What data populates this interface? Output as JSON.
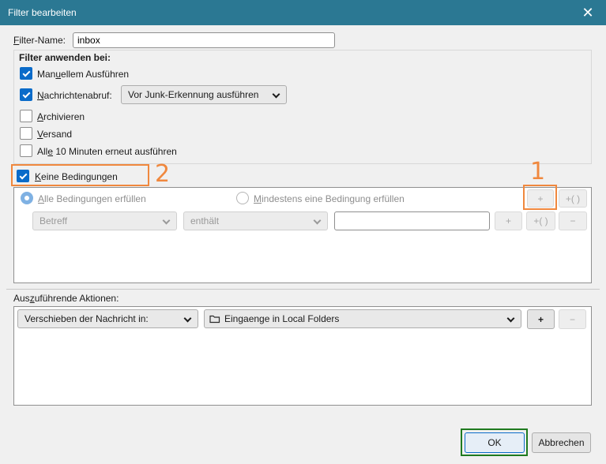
{
  "window": {
    "title": "Filter bearbeiten",
    "close_glyph": "✕"
  },
  "filter_name": {
    "label_prefix": "F",
    "label_rest": "ilter-Name:",
    "value": "inbox"
  },
  "apply_when": {
    "heading": "Filter anwenden bei:",
    "options": [
      {
        "pre": "Man",
        "key": "u",
        "post": "ellem Ausführen",
        "checked": true
      },
      {
        "pre": "",
        "key": "N",
        "post": "achrichtenabruf:",
        "checked": true
      },
      {
        "pre": "",
        "key": "A",
        "post": "rchivieren",
        "checked": false
      },
      {
        "pre": "",
        "key": "V",
        "post": "ersand",
        "checked": false
      },
      {
        "pre": "All",
        "key": "e",
        "post": " 10 Minuten erneut ausführen",
        "checked": false
      }
    ],
    "fetch_mode": "Vor Junk-Erkennung ausführen"
  },
  "conditions": {
    "no_conditions_pre": "",
    "no_conditions_key": "K",
    "no_conditions_post": "eine Bedingungen",
    "no_conditions_checked": true,
    "match_all_pre": "",
    "match_all_key": "A",
    "match_all_post": "lle Bedingungen erfüllen",
    "match_any_pre": "",
    "match_any_key": "M",
    "match_any_post": "indestens eine Bedingung erfüllen",
    "add_label": "+",
    "add_group_label": "+( )",
    "row": {
      "field": "Betreff",
      "operator": "enthält",
      "value": "",
      "add_label": "+",
      "add_group_label": "+( )",
      "remove_label": "−"
    }
  },
  "actions": {
    "heading_pre": "Aus",
    "heading_key": "z",
    "heading_post": "uführende Aktionen:",
    "action": "Verschieben der Nachricht in:",
    "target": "Eingaenge in Local Folders",
    "target_icon": "folder-icon",
    "add_label": "+",
    "remove_label": "−"
  },
  "footer": {
    "ok_label": "OK",
    "cancel_label": "Abbrechen"
  },
  "annotations": {
    "one": "1",
    "two": "2",
    "color": "#f0883e",
    "ok_highlight_color": "#1f7a1f"
  }
}
